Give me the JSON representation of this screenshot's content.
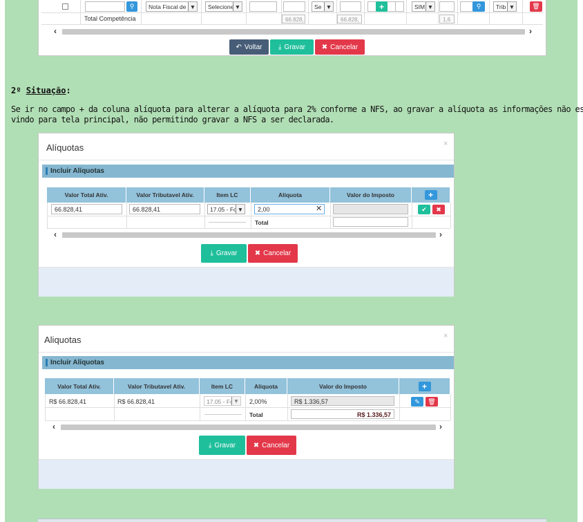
{
  "top": {
    "select_doc": "Nota Fiscal de S",
    "select_sel": "Selecione",
    "select_se": "Se",
    "select_sim": "SIM",
    "select_trib": "Trib",
    "total_label": "Total Competência",
    "val1": "66.828,",
    "val2": "66.828,",
    "val3": "1,6",
    "voltar": "Voltar",
    "gravar": "Gravar",
    "cancelar": "Cancelar"
  },
  "text": {
    "heading_num": "2º ",
    "heading_word": "Situação",
    "heading_colon": ":",
    "line1": "Se ir no campo + da coluna alíquota para alterar a alíquota para 2% conforme a NFS, ao gravar a alíquota as informações não estão",
    "line2": "vindo para tela principal, não permitindo gravar a NFS a ser declarada."
  },
  "modal1": {
    "title": "Alíquotas",
    "section": "Incluir Alíquotas",
    "headers": [
      "Valor Total Ativ.",
      "Valor Tributavel Ativ.",
      "Item LC",
      "Alíquota",
      "Valor do Imposto"
    ],
    "v_total": "66.828,41",
    "v_trib": "66.828,41",
    "item_lc": "17.05 - Fo",
    "aliquota": "2,00",
    "total": "Total",
    "gravar": "Gravar",
    "cancelar": "Cancelar"
  },
  "modal2": {
    "title": "Aliquotas",
    "section": "Incluir Alíquotas",
    "headers": [
      "Valor Total Ativ.",
      "Valor Tributavel Ativ.",
      "Item LC",
      "Aliquota",
      "Valor do Imposto"
    ],
    "v_total": "R$ 66.828,41",
    "v_trib": "R$ 66.828,41",
    "item_lc": "17.05 - Fo",
    "aliquota": "2,00%",
    "imposto": "R$ 1.336,57",
    "total": "Total",
    "total_value": "R$ 1.336,57",
    "gravar": "Gravar",
    "cancelar": "Cancelar"
  }
}
